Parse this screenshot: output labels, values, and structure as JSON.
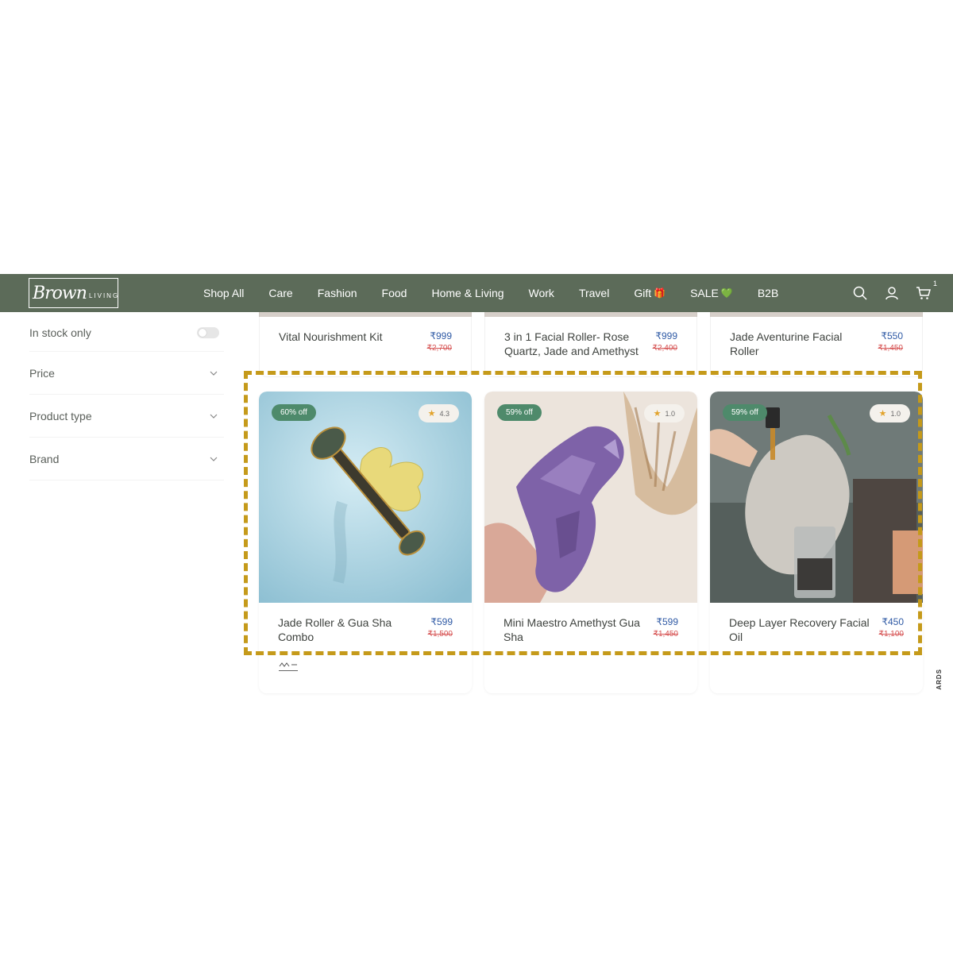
{
  "header": {
    "logo_script": "Brown",
    "logo_word": "LIVING",
    "nav": [
      "Shop All",
      "Care",
      "Fashion",
      "Food",
      "Home & Living",
      "Work",
      "Travel",
      "Gift",
      "SALE",
      "B2B"
    ],
    "gift_emoji": "🎁",
    "sale_emoji": "💚",
    "cart_count": "1",
    "icons": [
      "search-icon",
      "user-icon",
      "cart-icon"
    ]
  },
  "sidebar": {
    "in_stock_label": "In stock only",
    "filters": [
      "Price",
      "Product type",
      "Brand"
    ]
  },
  "top_products": [
    {
      "name": "Vital Nourishment Kit",
      "price": "₹999",
      "old_price": "₹2,700"
    },
    {
      "name": "3 in 1 Facial Roller- Rose Quartz, Jade and Amethyst",
      "price": "₹999",
      "old_price": "₹2,400"
    },
    {
      "name": "Jade Aventurine Facial Roller",
      "price": "₹550",
      "old_price": "₹1,450"
    }
  ],
  "products": [
    {
      "name": "Jade Roller & Gua Sha Combo",
      "price": "₹599",
      "old_price": "₹1,500",
      "discount": "60% off",
      "rating": "4.3"
    },
    {
      "name": "Mini Maestro Amethyst Gua Sha",
      "price": "₹599",
      "old_price": "₹1,450",
      "discount": "59% off",
      "rating": "1.0"
    },
    {
      "name": "Deep Layer Recovery Facial Oil",
      "price": "₹450",
      "old_price": "₹1,100",
      "discount": "59% off",
      "rating": "1.0"
    }
  ],
  "side_tab": "ARDS",
  "colors": {
    "nav_bg": "#5c6b59",
    "badge_green": "#4e8a6b",
    "highlight": "#c59a1a",
    "price_blue": "#2f5aa5",
    "old_price_red": "#d65252"
  }
}
